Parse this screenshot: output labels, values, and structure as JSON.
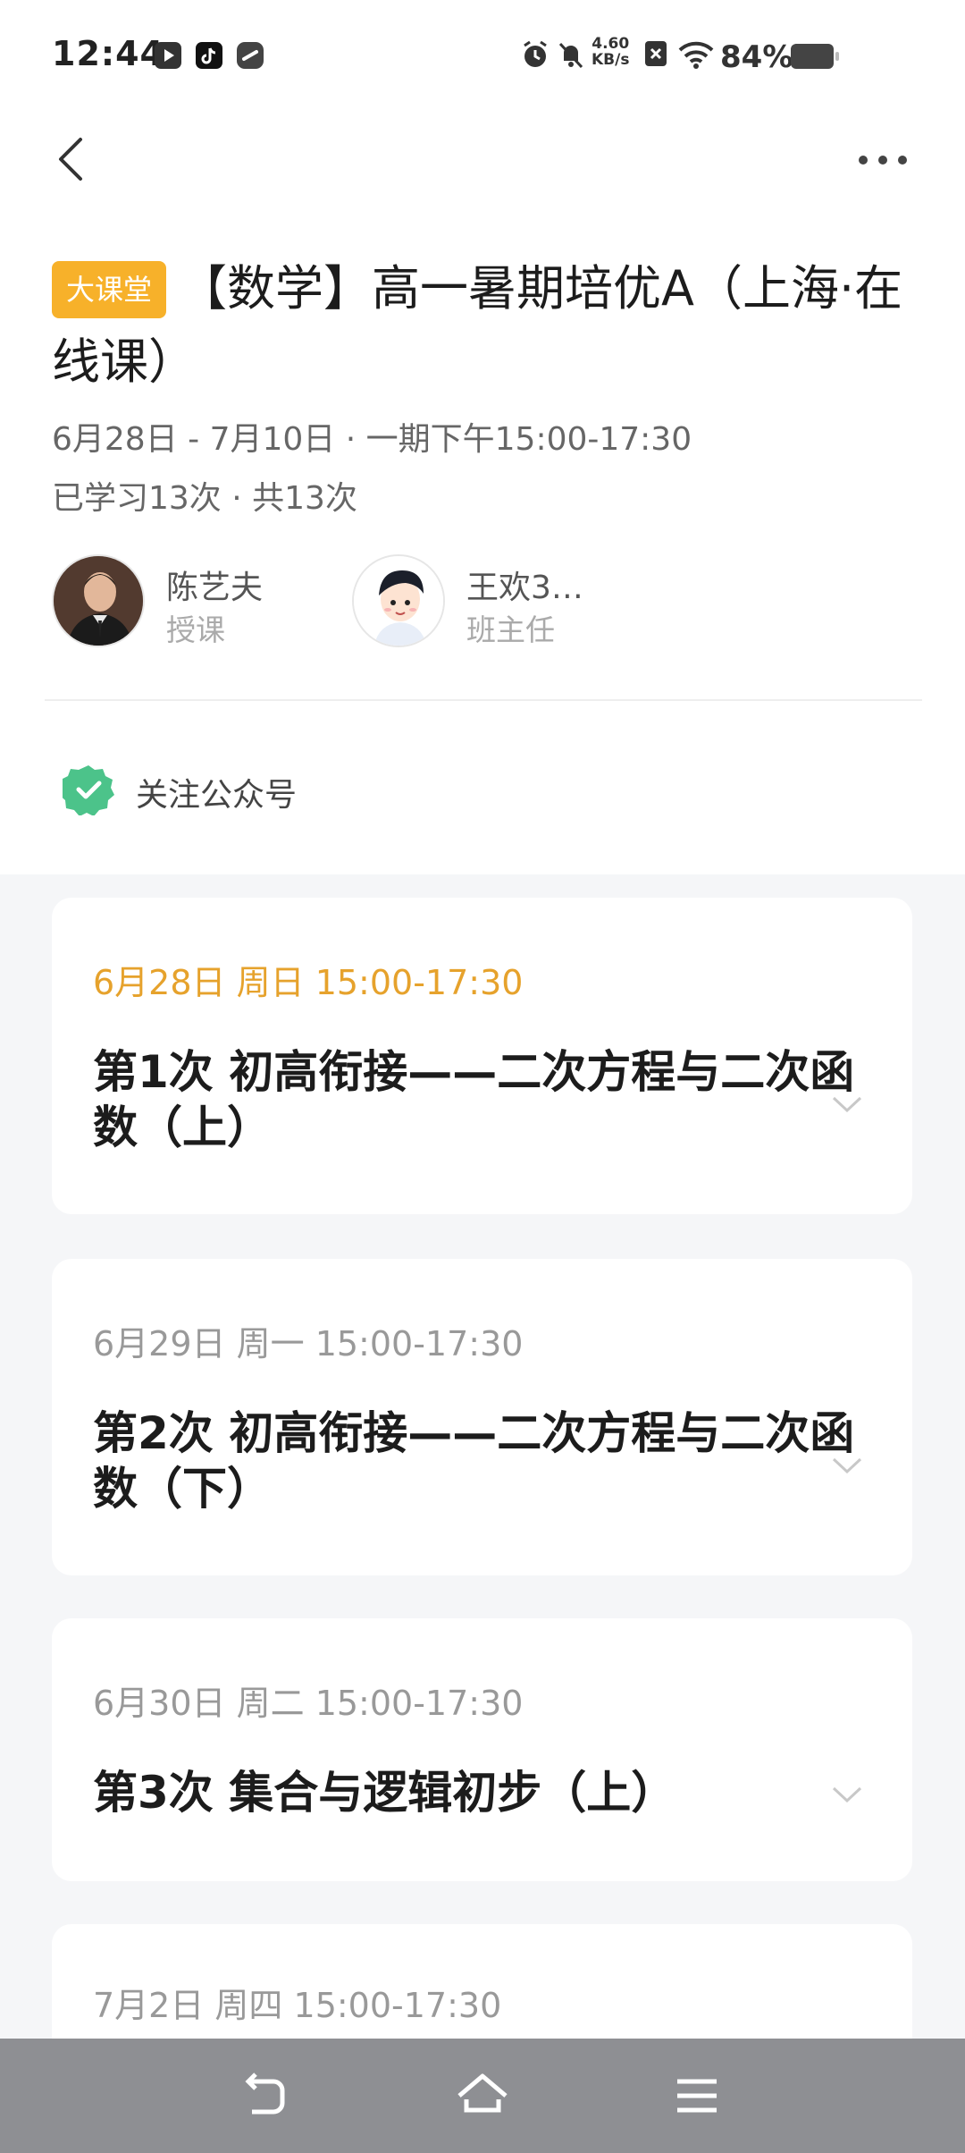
{
  "status_bar": {
    "time": "12:44",
    "net_speed_value": "4.60",
    "net_speed_unit": "KB/s",
    "battery": "84%",
    "icons": [
      "video-app-icon",
      "tiktok-icon",
      "link-app-icon",
      "alarm-icon",
      "mute-icon",
      "sim-off-icon",
      "wifi-icon",
      "battery-icon"
    ]
  },
  "nav": {
    "back_icon": "chevron-left-icon",
    "more_icon": "more-horizontal-icon"
  },
  "course": {
    "tag": "大课堂",
    "title": "【数学】高一暑期培优A（上海·在线课）",
    "schedule": "6月28日 - 7月10日 · 一期下午15:00-17:30",
    "progress": "已学习13次 · 共13次",
    "tag_color": "#f7b12a"
  },
  "teachers": [
    {
      "name": "陈艺夫",
      "role": "授课"
    },
    {
      "name": "王欢3…",
      "role": "班主任"
    }
  ],
  "follow": {
    "label": "关注公众号",
    "icon": "verified-badge-icon",
    "icon_color": "#4cc38a"
  },
  "lessons": [
    {
      "date": "6月28日 周日 15:00-17:30",
      "title": "第1次  初高衔接——二次方程与二次函数（上）",
      "active": true
    },
    {
      "date": "6月29日 周一 15:00-17:30",
      "title": "第2次  初高衔接——二次方程与二次函数（下）",
      "active": false
    },
    {
      "date": "6月30日 周二 15:00-17:30",
      "title": "第3次  集合与逻辑初步（上）",
      "active": false
    },
    {
      "date": "7月2日 周四 15:00-17:30",
      "title": "",
      "active": false
    }
  ],
  "bottom_nav": {
    "icons": [
      "back-gesture-icon",
      "home-icon",
      "menu-icon"
    ]
  }
}
